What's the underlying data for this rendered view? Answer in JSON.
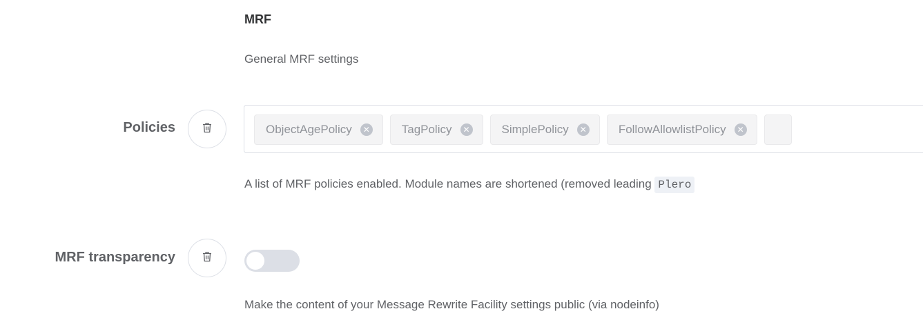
{
  "section": {
    "title": "MRF",
    "description": "General MRF settings"
  },
  "policies": {
    "label": "Policies",
    "delete_icon": "trash-icon",
    "tags": [
      {
        "label": "ObjectAgePolicy",
        "remove_icon": "close-circle-icon"
      },
      {
        "label": "TagPolicy",
        "remove_icon": "close-circle-icon"
      },
      {
        "label": "SimplePolicy",
        "remove_icon": "close-circle-icon"
      },
      {
        "label": "FollowAllowlistPolicy",
        "remove_icon": "close-circle-icon"
      }
    ],
    "help_text": "A list of MRF policies enabled. Module names are shortened (removed leading ",
    "help_code": "Plero"
  },
  "transparency": {
    "label": "MRF transparency",
    "delete_icon": "trash-icon",
    "enabled": false,
    "help_text": "Make the content of your Message Rewrite Facility settings public (via nodeinfo)"
  },
  "colors": {
    "border": "#dcdfe6",
    "tag_bg": "#f4f4f5",
    "tag_text": "#909399",
    "switch_off": "#dcdfe6",
    "text": "#606266"
  }
}
